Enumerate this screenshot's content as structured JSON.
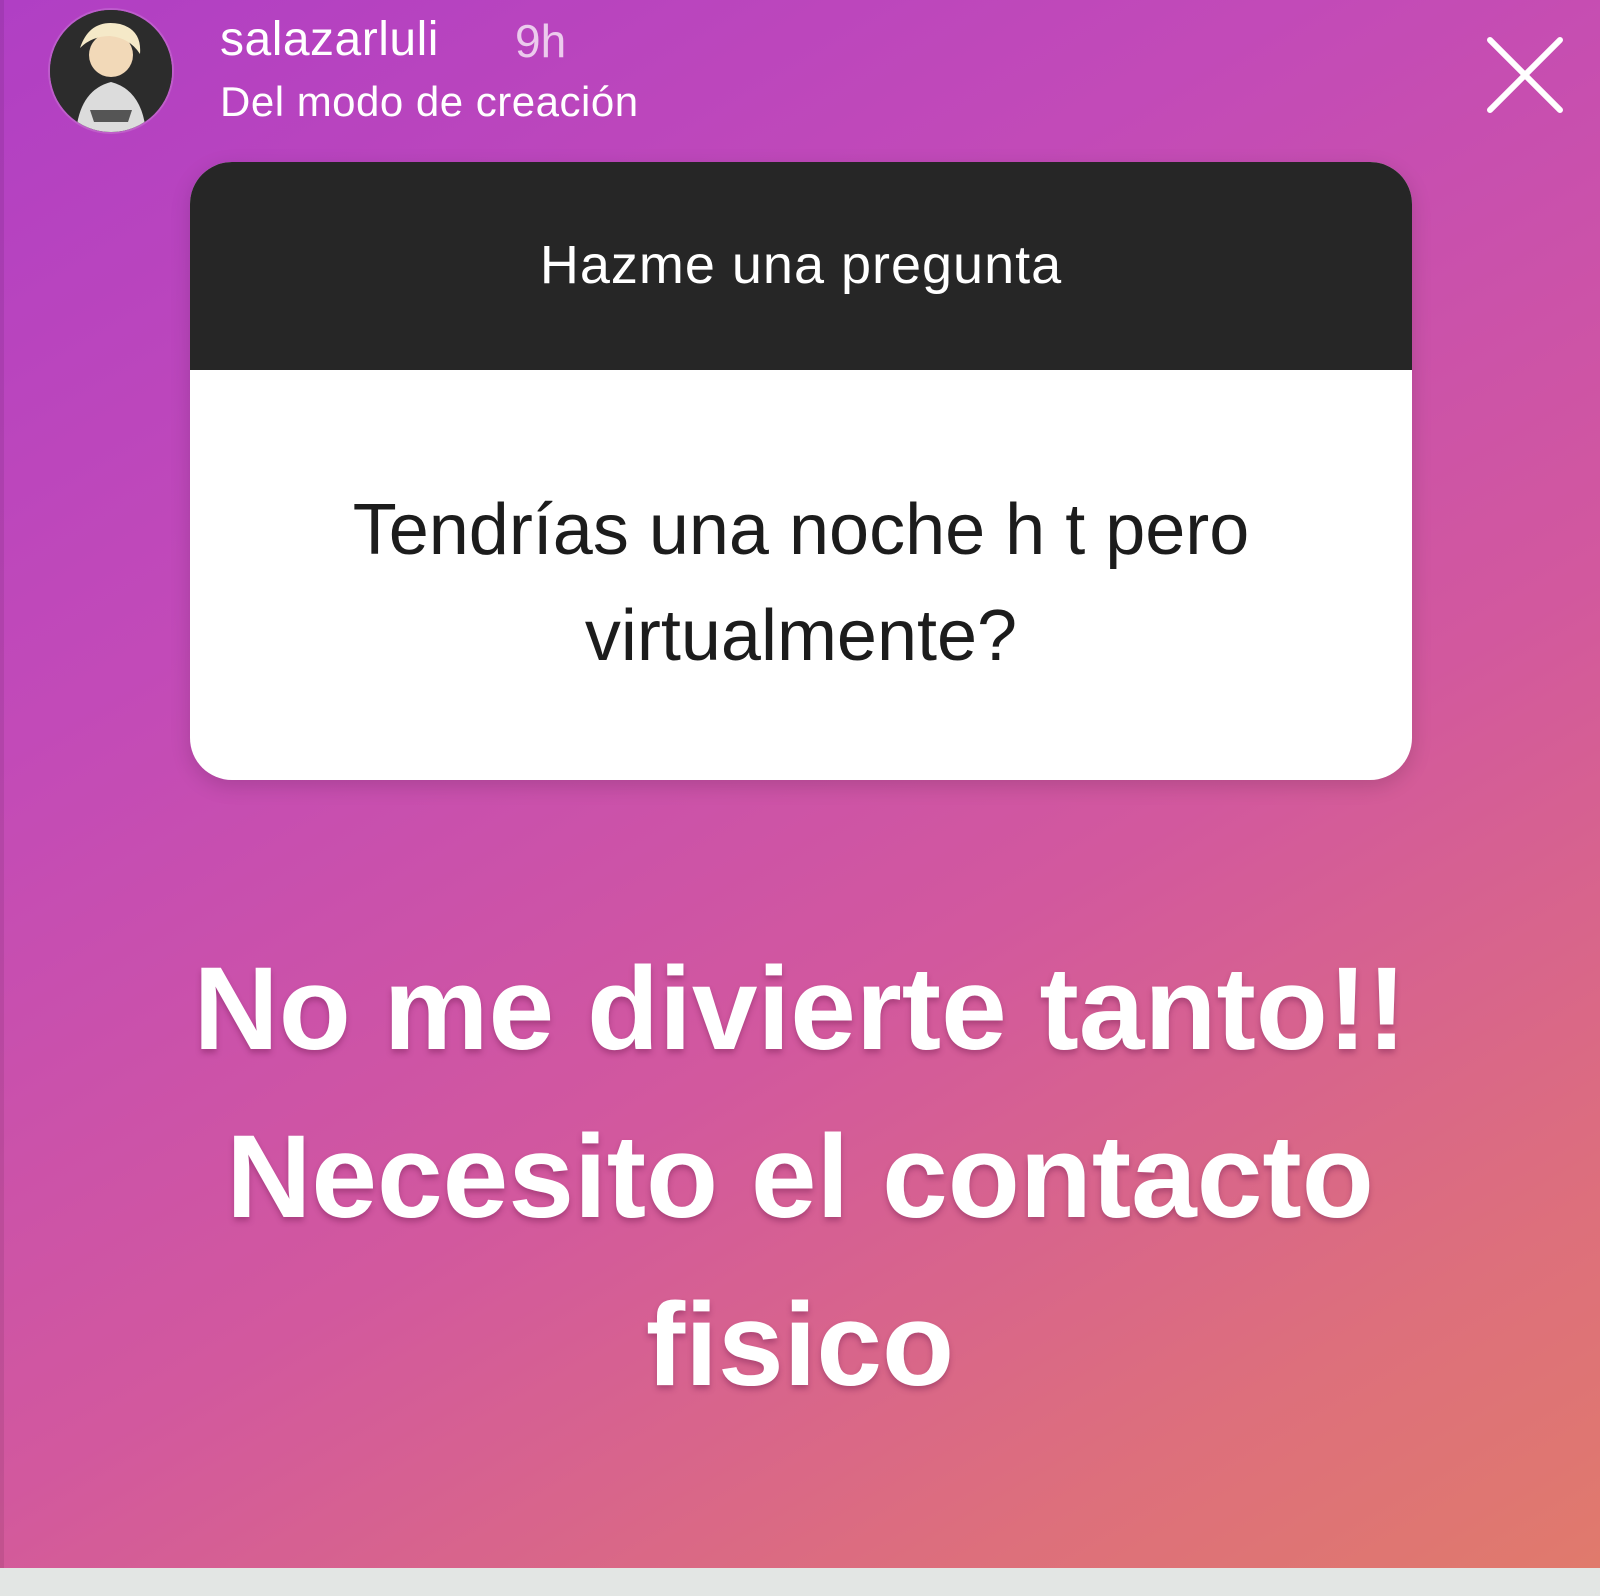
{
  "header": {
    "username": "salazarluli",
    "time": "9h",
    "subtitle": "Del modo de creación",
    "avatar_icon": "profile-photo-avatar",
    "close_icon": "close-x-icon"
  },
  "question_card": {
    "title": "Hazme una pregunta",
    "question": "Tendrías una noche h  t pero virtualmente?"
  },
  "answer": {
    "text": "No me divierte tanto!! Necesito el contacto fisico"
  },
  "colors": {
    "gradient_start": "#b03fc4",
    "gradient_end": "#e07a6c",
    "card_header": "#262626",
    "card_body": "#ffffff",
    "text_light": "#ffffff"
  }
}
